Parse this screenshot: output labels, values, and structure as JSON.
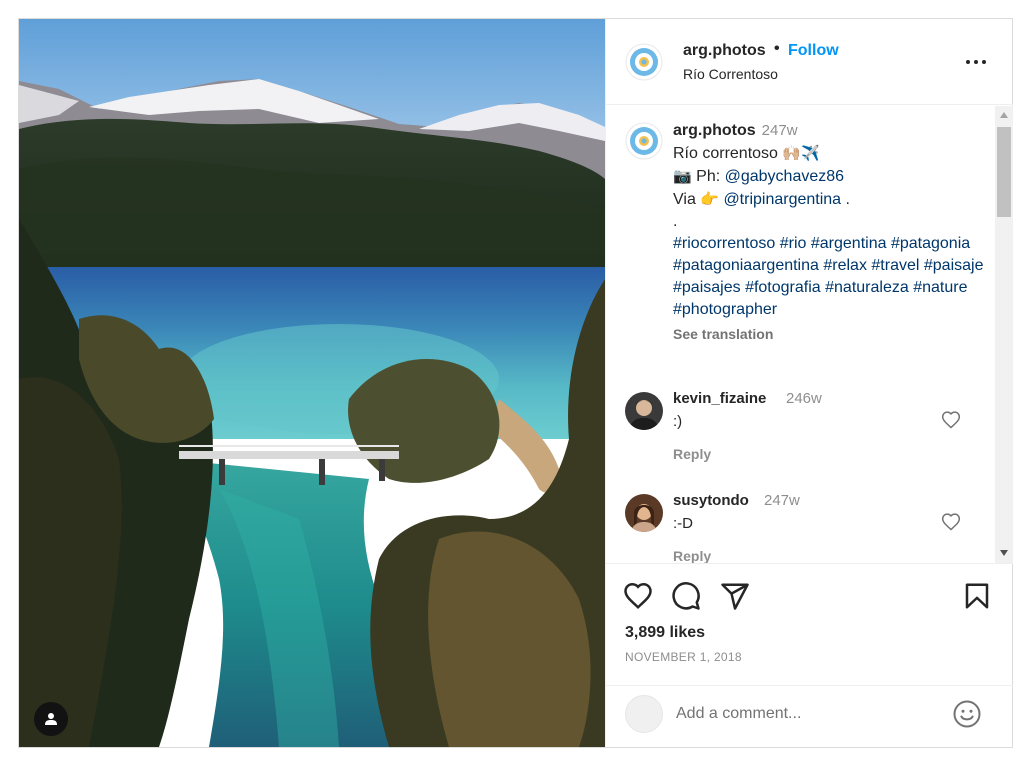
{
  "post": {
    "username": "arg.photos",
    "follow_label": "Follow",
    "separator": "•",
    "location": "Río Correntoso"
  },
  "caption": {
    "username": "arg.photos",
    "time": "247w",
    "line1": "Río correntoso",
    "line1_emoji": "🙌🏼✈️",
    "ph_prefix": "Ph:",
    "ph_handle": "@gabychavez86",
    "via_prefix": "Via",
    "via_handle": "@tripinargentina",
    "via_suffix": ".",
    "dot_line": ".",
    "hashtags": [
      "#riocorrentoso",
      "#rio",
      "#argentina",
      "#patagonia",
      "#patagoniaargentina",
      "#relax",
      "#travel",
      "#paisaje",
      "#paisajes",
      "#fotografia",
      "#naturaleza",
      "#nature",
      "#photographer"
    ],
    "see_translation": "See translation"
  },
  "comments": [
    {
      "username": "kevin_fizaine",
      "time": "246w",
      "text": ":)",
      "reply_label": "Reply"
    },
    {
      "username": "susytondo",
      "time": "247w",
      "text": ":-D",
      "reply_label": "Reply"
    }
  ],
  "actions": {
    "likes": "3,899 likes",
    "date": "NOVEMBER 1, 2018"
  },
  "add_comment": {
    "placeholder": "Add a comment..."
  },
  "icons": {
    "like": "heart-icon",
    "comment": "speech-bubble-icon",
    "share": "paper-plane-icon",
    "save": "bookmark-icon",
    "more": "more-dots-icon",
    "tag": "user-tag-icon",
    "emoji": "smiley-icon"
  },
  "colors": {
    "follow": "#0095f6",
    "link": "#00376b",
    "muted": "#8e8e8e"
  }
}
